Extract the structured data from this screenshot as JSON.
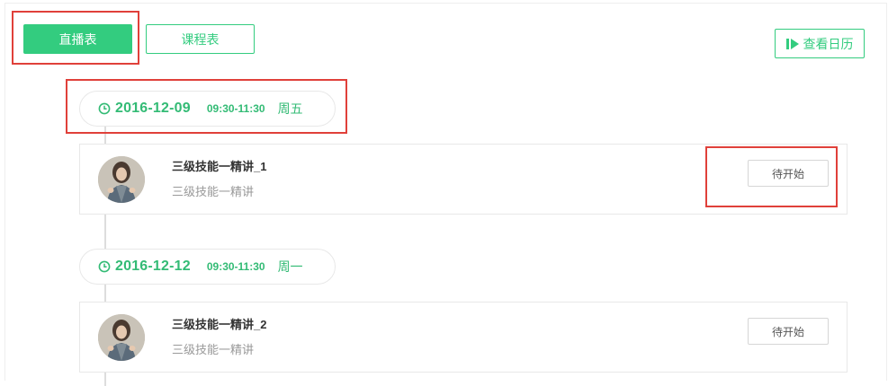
{
  "tabs": {
    "live_label": "直播表",
    "course_label": "课程表"
  },
  "calendar": {
    "label": "查看日历",
    "icon": "play-icon"
  },
  "schedule": [
    {
      "date": "2016-12-09",
      "time": "09:30-11:30",
      "weekday": "周五",
      "title": "三级技能一精讲_1",
      "subtitle": "三级技能一精讲",
      "status": "待开始"
    },
    {
      "date": "2016-12-12",
      "time": "09:30-11:30",
      "weekday": "周一",
      "title": "三级技能一精讲_2",
      "subtitle": "三级技能一精讲",
      "status": "待开始"
    }
  ],
  "colors": {
    "accent": "#33cc7f",
    "highlight": "#e0403a"
  }
}
